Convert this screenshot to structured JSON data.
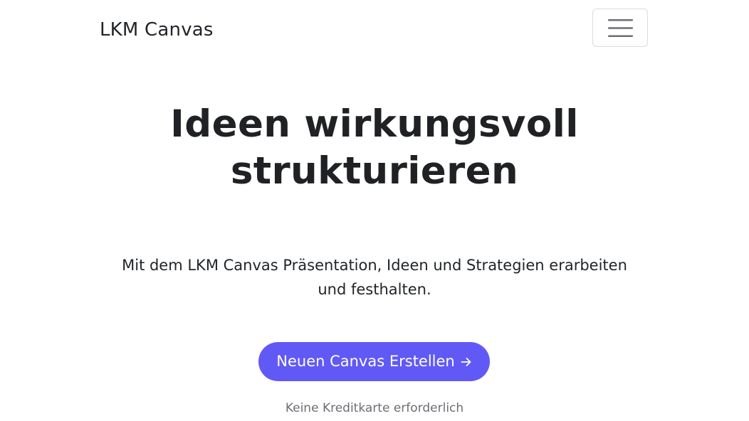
{
  "navbar": {
    "brand": "LKM Canvas",
    "menu_icon": "hamburger-icon"
  },
  "hero": {
    "headline_line1": "Ideen wirkungsvoll",
    "headline_line2": "strukturieren",
    "subtext": "Mit dem LKM Canvas Präsentation, Ideen und Strategien erarbeiten und festhalten.",
    "cta_label": "Neuen Canvas Erstellen",
    "cta_icon": "arrow-right-icon",
    "note": "Keine Kreditkarte erforderlich"
  },
  "colors": {
    "accent": "#6159f5",
    "text": "#1f2125",
    "muted": "#6b6e73",
    "border": "#d9dbde",
    "background": "#ffffff"
  }
}
